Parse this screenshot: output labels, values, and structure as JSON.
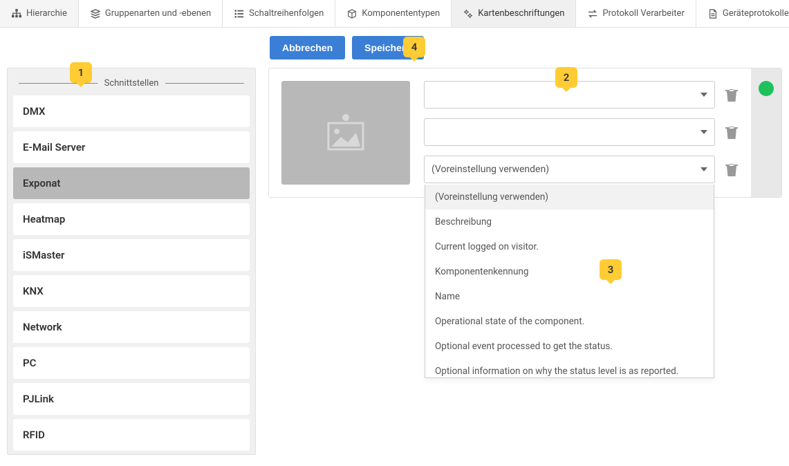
{
  "tabs": [
    {
      "label": "Hierarchie",
      "icon": "hierarchy"
    },
    {
      "label": "Gruppenarten und -ebenen",
      "icon": "layers"
    },
    {
      "label": "Schaltreihenfolgen",
      "icon": "list"
    },
    {
      "label": "Komponententypen",
      "icon": "cube"
    },
    {
      "label": "Kartenbeschriftungen",
      "icon": "gears"
    },
    {
      "label": "Protokoll Verarbeiter",
      "icon": "swap"
    },
    {
      "label": "Geräteprotokolle",
      "icon": "doc"
    }
  ],
  "active_tab": 4,
  "buttons": {
    "cancel": "Abbrechen",
    "save": "Speichern"
  },
  "sidebar": {
    "header": "Schnittstellen",
    "items": [
      "DMX",
      "E-Mail Server",
      "Exponat",
      "Heatmap",
      "iSMaster",
      "KNX",
      "Network",
      "PC",
      "PJLink",
      "RFID"
    ],
    "selected": 2
  },
  "fields": {
    "row0": {
      "value": ""
    },
    "row1": {
      "value": ""
    },
    "row2": {
      "value": "(Voreinstellung verwenden)"
    }
  },
  "dropdown": {
    "items": [
      "(Voreinstellung verwenden)",
      "Beschreibung",
      "Current logged on visitor.",
      "Komponentenkennung",
      "Name",
      "Operational state of the component.",
      "Optional event processed to get the status.",
      "Optional information on why the status level is as reported."
    ],
    "highlighted": 0
  },
  "callouts": {
    "c1": "1",
    "c2": "2",
    "c3": "3",
    "c4": "4"
  },
  "colors": {
    "accent": "#3a7fd5",
    "status_ok": "#1fc15a",
    "callout": "#ffcc33"
  }
}
